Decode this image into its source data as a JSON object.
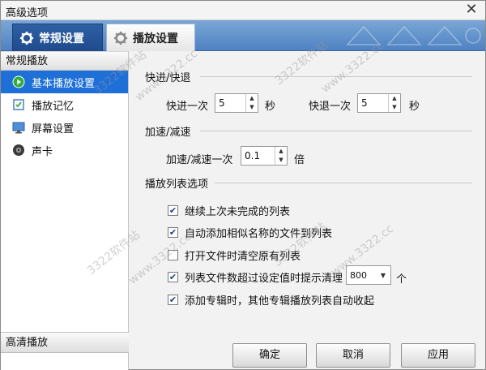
{
  "window": {
    "title": "高级选项",
    "close_label": "✕"
  },
  "tabs": [
    {
      "label": "常规设置",
      "icon": "gear-icon"
    },
    {
      "label": "播放设置",
      "icon": "gear-icon"
    }
  ],
  "sidebar": {
    "header": "常规播放",
    "items": [
      {
        "label": "基本播放设置",
        "icon": "play-circle-icon",
        "selected": true
      },
      {
        "label": "播放记忆",
        "icon": "memory-icon",
        "selected": false
      },
      {
        "label": "屏幕设置",
        "icon": "monitor-icon",
        "selected": false
      },
      {
        "label": "声卡",
        "icon": "speaker-icon",
        "selected": false
      }
    ],
    "footer": "高清播放"
  },
  "content": {
    "seek": {
      "title": "快进/快退",
      "forward_label": "快进一次",
      "forward_value": "5",
      "forward_unit": "秒",
      "backward_label": "快退一次",
      "backward_value": "5",
      "backward_unit": "秒"
    },
    "speed": {
      "title": "加速/减速",
      "label": "加速/减速一次",
      "value": "0.1",
      "unit": "倍"
    },
    "playlist": {
      "title": "播放列表选项",
      "options": [
        {
          "label": "继续上次未完成的列表",
          "checked": true
        },
        {
          "label": "自动添加相似名称的文件到列表",
          "checked": true
        },
        {
          "label": "打开文件时清空原有列表",
          "checked": false
        },
        {
          "label": "列表文件数超过设定值时提示清理",
          "checked": true
        },
        {
          "label": "添加专辑时，其他专辑播放列表自动收起",
          "checked": true
        }
      ],
      "limit_value": "800",
      "limit_unit": "个"
    }
  },
  "buttons": {
    "ok": "确定",
    "cancel": "取消",
    "apply": "应用"
  },
  "watermark": [
    "3322软件站",
    "www.3322.cc"
  ],
  "colors": {
    "accent": "#1e6fd8",
    "tab_bar": "#4f82c2"
  }
}
